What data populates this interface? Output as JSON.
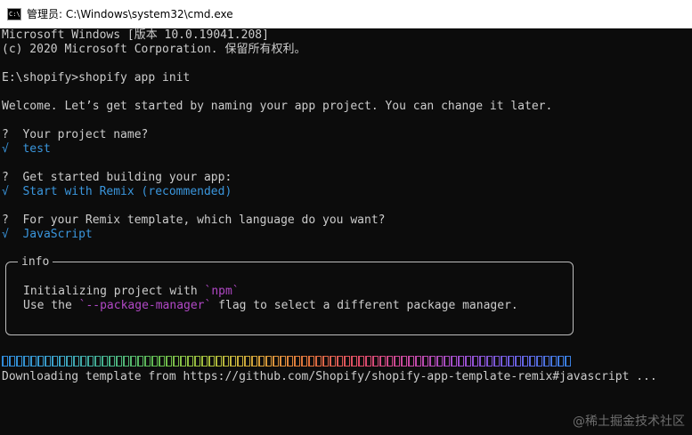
{
  "window": {
    "icon": "cmd-icon",
    "icon_text": "C:\\",
    "title": "管理员: C:\\Windows\\system32\\cmd.exe"
  },
  "console": {
    "version_line": "Microsoft Windows [版本 10.0.19041.208]",
    "copyright_line": "(c) 2020 Microsoft Corporation. 保留所有权利。",
    "prompt_line": "E:\\shopify>shopify app init",
    "welcome_line": "Welcome. Let’s get started by naming your app project. You can change it later.",
    "q1": {
      "question": "?  Your project name?",
      "mark": "√",
      "answer": "test"
    },
    "q2": {
      "question": "?  Get started building your app:",
      "mark": "√",
      "answer": "Start with Remix (recommended)"
    },
    "q3": {
      "question": "?  For your Remix template, which language do you want?",
      "mark": "√",
      "answer": "JavaScript"
    },
    "info_box": {
      "label": "info",
      "line1_prefix": "Initializing project with ",
      "line1_code": "`npm`",
      "line2_prefix": "Use the ",
      "line2_code": "`--package-manager`",
      "line2_suffix": " flag to select a different package manager."
    },
    "progress": {
      "fraction": 1.0,
      "gradient_colors": [
        "#2f8ad8",
        "#3aa0c8",
        "#45b18a",
        "#63bb4e",
        "#a9bf3b",
        "#d9a13a",
        "#e0703c",
        "#de4a6a",
        "#c449a8",
        "#9a4fd0",
        "#6a5fe0",
        "#3a7fe2"
      ]
    },
    "download_line": "Downloading template from https://github.com/Shopify/shopify-app-template-remix#javascript ..."
  },
  "watermark": "@稀土掘金技术社区",
  "colors": {
    "background": "#0c0c0c",
    "text": "#cccccc",
    "answer": "#3a96dd",
    "code": "#b148c6"
  }
}
